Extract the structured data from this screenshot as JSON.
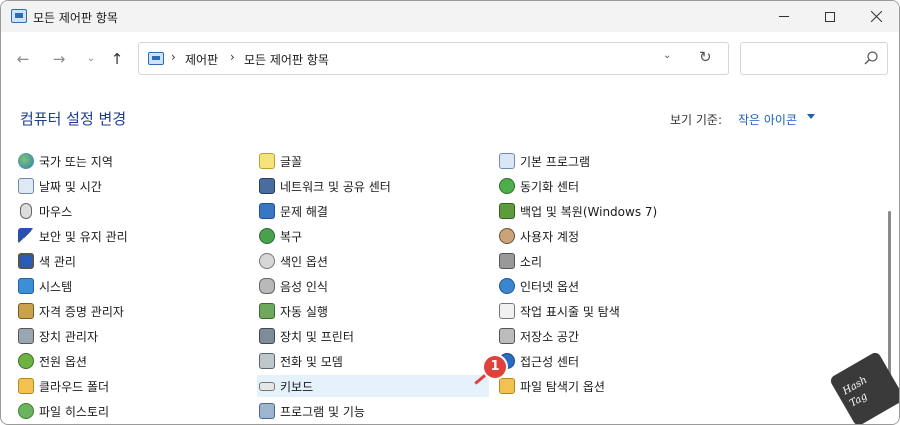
{
  "window": {
    "title": "모든 제어판 항목"
  },
  "nav": {
    "back_icon": "←",
    "forward_icon": "→",
    "recent_icon": "⌄",
    "up_icon": "↑"
  },
  "address": {
    "sep1": "›",
    "crumb1": "제어판",
    "sep2": "›",
    "crumb2": "모든 제어판 항목",
    "dropdown_icon": "⌄",
    "refresh_icon": "↻"
  },
  "search": {
    "value": "",
    "placeholder": ""
  },
  "header": {
    "title": "컴퓨터 설정 변경",
    "view_by_label": "보기 기준:",
    "view_by_value": "작은 아이콘"
  },
  "items": {
    "col1": [
      {
        "label": "국가 또는 지역",
        "icon": "globe-icon"
      },
      {
        "label": "날짜 및 시간",
        "icon": "calendar-clock-icon"
      },
      {
        "label": "마우스",
        "icon": "mouse-icon"
      },
      {
        "label": "보안 및 유지 관리",
        "icon": "flag-icon"
      },
      {
        "label": "색 관리",
        "icon": "color-monitor-icon"
      },
      {
        "label": "시스템",
        "icon": "system-icon"
      },
      {
        "label": "자격 증명 관리자",
        "icon": "credential-vault-icon"
      },
      {
        "label": "장치 관리자",
        "icon": "device-manager-icon"
      },
      {
        "label": "전원 옵션",
        "icon": "power-options-icon"
      },
      {
        "label": "클라우드 폴더",
        "icon": "cloud-folder-icon"
      },
      {
        "label": "파일 히스토리",
        "icon": "file-history-icon"
      }
    ],
    "col2": [
      {
        "label": "글꼴",
        "icon": "font-icon"
      },
      {
        "label": "네트워크 및 공유 센터",
        "icon": "network-icon"
      },
      {
        "label": "문제 해결",
        "icon": "troubleshoot-icon"
      },
      {
        "label": "복구",
        "icon": "recovery-icon"
      },
      {
        "label": "색인 옵션",
        "icon": "indexing-icon"
      },
      {
        "label": "음성 인식",
        "icon": "microphone-icon"
      },
      {
        "label": "자동 실행",
        "icon": "autoplay-icon"
      },
      {
        "label": "장치 및 프린터",
        "icon": "printer-icon"
      },
      {
        "label": "전화 및 모뎀",
        "icon": "phone-modem-icon"
      },
      {
        "label": "키보드",
        "icon": "keyboard-icon"
      },
      {
        "label": "프로그램 및 기능",
        "icon": "programs-icon"
      }
    ],
    "col3": [
      {
        "label": "기본 프로그램",
        "icon": "default-programs-icon"
      },
      {
        "label": "동기화 센터",
        "icon": "sync-center-icon"
      },
      {
        "label": "백업 및 복원(Windows 7)",
        "icon": "backup-restore-icon"
      },
      {
        "label": "사용자 계정",
        "icon": "user-accounts-icon"
      },
      {
        "label": "소리",
        "icon": "speaker-icon"
      },
      {
        "label": "인터넷 옵션",
        "icon": "internet-options-icon"
      },
      {
        "label": "작업 표시줄 및 탐색",
        "icon": "taskbar-icon"
      },
      {
        "label": "저장소 공간",
        "icon": "storage-spaces-icon"
      },
      {
        "label": "접근성 센터",
        "icon": "accessibility-icon"
      },
      {
        "label": "파일 탐색기 옵션",
        "icon": "file-explorer-options-icon"
      }
    ]
  },
  "callout": {
    "number": "1",
    "color": "#e0413b"
  },
  "watermark": {
    "line1": "Hash",
    "line2": "Tag"
  },
  "colors": {
    "title_blue": "#1e3d8f",
    "link_blue": "#1a5fb4",
    "highlight": "#e5f1fb"
  }
}
